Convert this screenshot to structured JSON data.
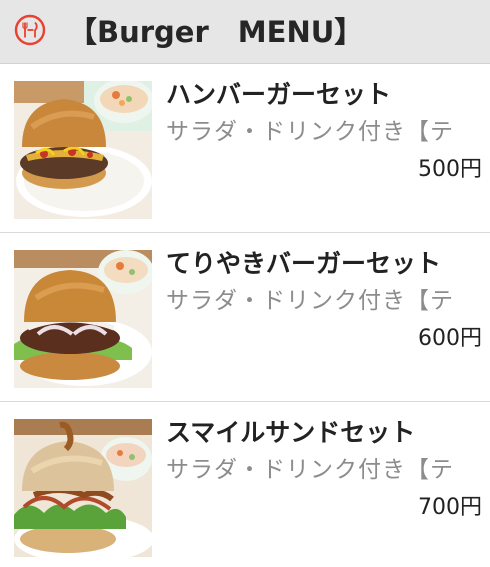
{
  "header": {
    "logo_icon": "restaurant-logo-icon",
    "title": "【Burger　MENU】",
    "background": "#e6e6e6",
    "logo_color": "#e8412f"
  },
  "items": [
    {
      "image_icon": "hamburger-set-photo",
      "name": "ハンバーガーセット",
      "description": "サラダ・ドリンク付き【テ",
      "price": "500円"
    },
    {
      "image_icon": "teriyaki-burger-set-photo",
      "name": "てりやきバーガーセット",
      "description": "サラダ・ドリンク付き【テ",
      "price": "600円"
    },
    {
      "image_icon": "smile-sandwich-set-photo",
      "name": "スマイルサンドセット",
      "description": "サラダ・ドリンク付き【テ",
      "price": "700円"
    }
  ]
}
